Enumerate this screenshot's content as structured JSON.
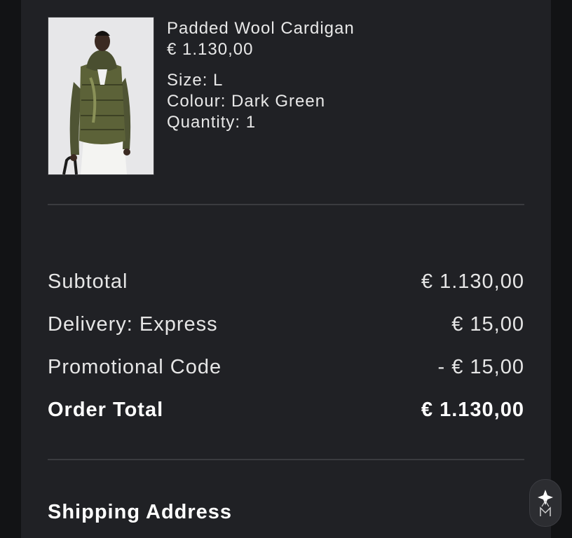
{
  "product": {
    "name": "Padded Wool Cardigan",
    "price": "€ 1.130,00",
    "size": "Size: L",
    "colour": "Colour: Dark Green",
    "quantity": "Quantity: 1",
    "image_icon": "product-photo"
  },
  "summary": {
    "rows": [
      {
        "label": "Subtotal",
        "value": "€ 1.130,00"
      },
      {
        "label": "Delivery: Express",
        "value": "€ 15,00"
      },
      {
        "label": "Promotional Code",
        "value": "- € 15,00"
      }
    ],
    "total": {
      "label": "Order Total",
      "value": "€ 1.130,00"
    }
  },
  "shipping": {
    "title": "Shipping Address"
  },
  "assistant": {
    "icon": "brand-assistant-icon"
  },
  "colors": {
    "background": "#121315",
    "panel": "#202125",
    "divider": "#3a3b3f",
    "text": "#ececec"
  }
}
